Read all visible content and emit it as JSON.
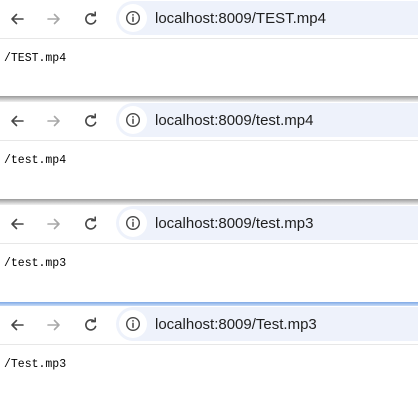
{
  "colors": {
    "omnibox_bg": "#eef2fb",
    "icon_active": "#474747",
    "icon_disabled": "#a8a8a8"
  },
  "icons": {
    "back": "arrow-left-icon",
    "forward": "arrow-right-icon",
    "reload": "reload-icon",
    "site_info": "info-circle-icon"
  },
  "windows": [
    {
      "url": "localhost:8009/TEST.mp4",
      "body_text": "/TEST.mp4"
    },
    {
      "url": "localhost:8009/test.mp4",
      "body_text": "/test.mp4"
    },
    {
      "url": "localhost:8009/test.mp3",
      "body_text": "/test.mp3"
    },
    {
      "url": "localhost:8009/Test.mp3",
      "body_text": "/Test.mp3"
    }
  ]
}
